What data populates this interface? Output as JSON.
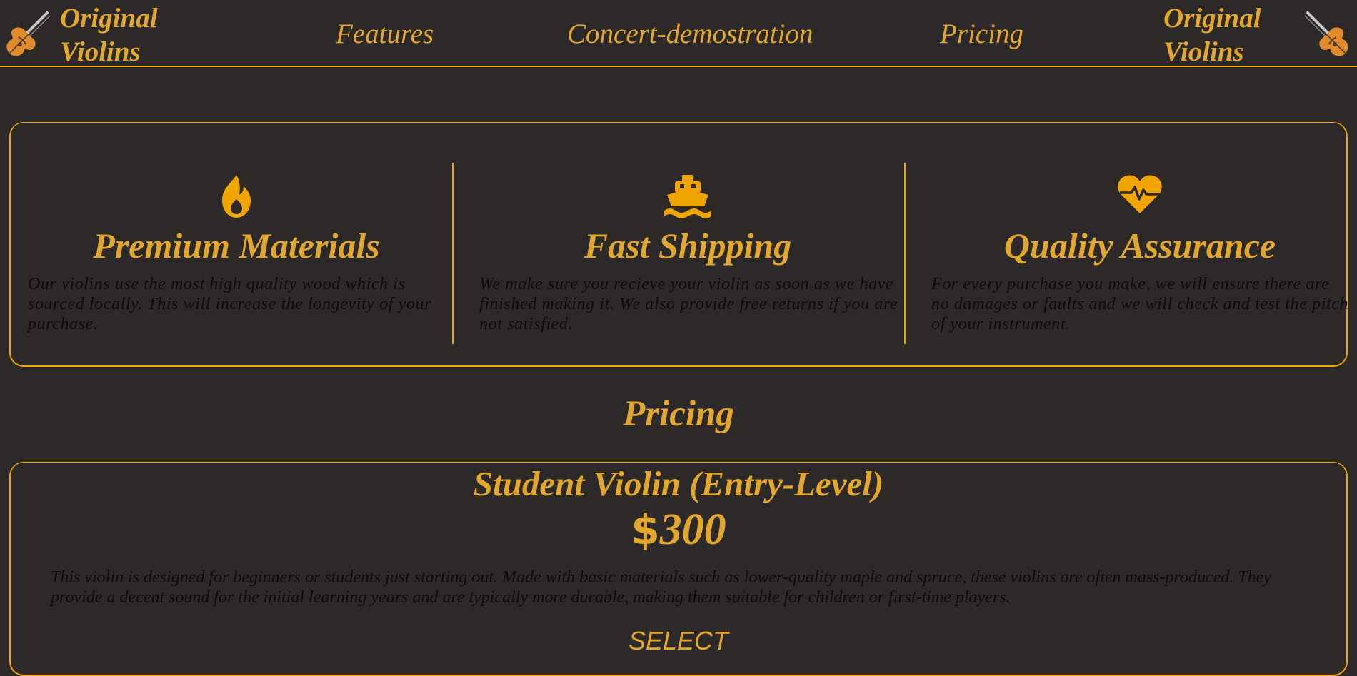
{
  "nav": {
    "logo_text_left": "Original Violins",
    "logo_text_right": "Original Violins",
    "logo_icon": "violin-icon",
    "links": [
      {
        "label": "Features"
      },
      {
        "label": "Concert-demostration"
      },
      {
        "label": "Pricing"
      }
    ]
  },
  "features": [
    {
      "icon": "fire-icon",
      "title": "Premium Materials",
      "text": "Our violins use the most high quality wood which is sourced locally. This will increase the longevity of your purchase."
    },
    {
      "icon": "ship-icon",
      "title": "Fast Shipping",
      "text": "We make sure you recieve your violin as soon as we have finished making it. We also provide free returns if you are not satisfied."
    },
    {
      "icon": "heart-pulse-icon",
      "title": "Quality Assurance",
      "text": "For every purchase you make, we will ensure there are no damages or faults and we will check and test the pitch of your instrument."
    }
  ],
  "pricing": {
    "title": "Pricing",
    "plan": {
      "name": "Student Violin (Entry-Level)",
      "currency": "$",
      "amount": "300",
      "description": "This violin is designed for beginners or students just starting out. Made with basic materials such as lower-quality maple and spruce, these violins are often mass-produced. They provide a decent sound for the initial learning years and are typically more durable, making them suitable for children or first-time players.",
      "select_label": "SELECT"
    }
  },
  "colors": {
    "background": "#2d2928",
    "accent": "#e2a72e",
    "border": "#f0a500",
    "body_text": "#0d0c0c"
  }
}
